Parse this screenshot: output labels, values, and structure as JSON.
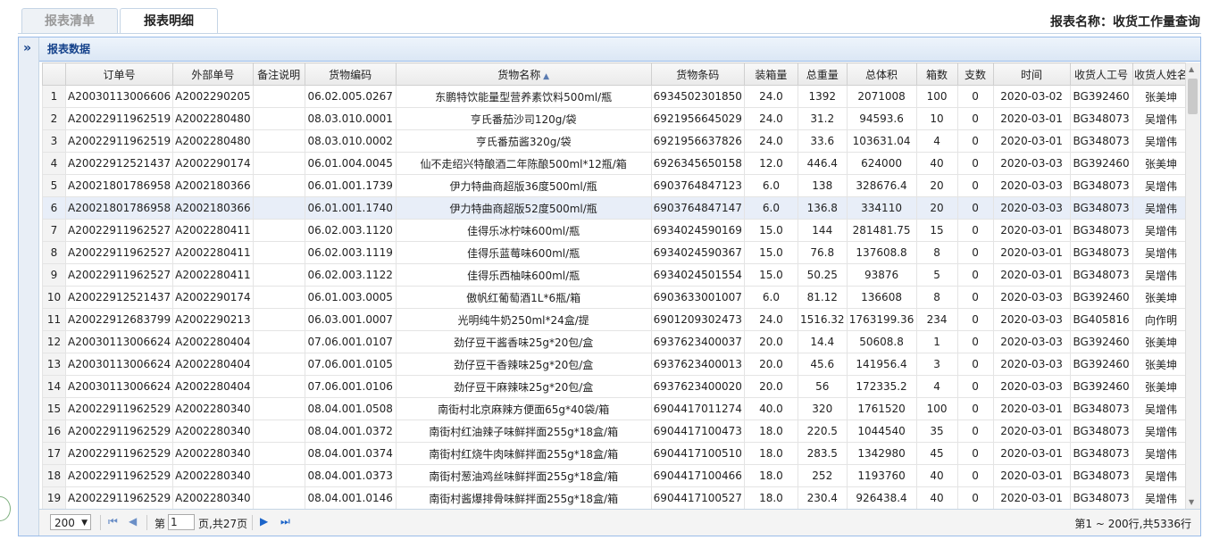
{
  "tabs": [
    {
      "label": "报表清单",
      "active": false
    },
    {
      "label": "报表明细",
      "active": true
    }
  ],
  "report_name": "报表名称：收货工作量查询",
  "panel": {
    "title": "报表数据",
    "expand_icon": "»"
  },
  "columns": [
    "",
    "订单号",
    "外部单号",
    "备注说明",
    "货物编码",
    "货物名称",
    "货物条码",
    "装箱量",
    "总重量",
    "总体积",
    "箱数",
    "支数",
    "时间",
    "收货人工号",
    "收货人姓名"
  ],
  "sorted_column": "货物名称",
  "rows": [
    [
      "1",
      "A20030113006606",
      "A2002290205",
      "",
      "06.02.005.0267",
      "东鹏特饮能量型营养素饮料500ml/瓶",
      "6934502301850",
      "24.0",
      "1392",
      "2071008",
      "100",
      "0",
      "2020-03-02",
      "BG392460",
      "张美坤"
    ],
    [
      "2",
      "A20022911962519",
      "A2002280480",
      "",
      "08.03.010.0001",
      "亨氏番茄沙司120g/袋",
      "6921956645029",
      "24.0",
      "31.2",
      "94593.6",
      "10",
      "0",
      "2020-03-01",
      "BG348073",
      "吴增伟"
    ],
    [
      "3",
      "A20022911962519",
      "A2002280480",
      "",
      "08.03.010.0002",
      "亨氏番茄酱320g/袋",
      "6921956637826",
      "24.0",
      "33.6",
      "103631.04",
      "4",
      "0",
      "2020-03-01",
      "BG348073",
      "吴增伟"
    ],
    [
      "4",
      "A20022912521437",
      "A2002290174",
      "",
      "06.01.004.0045",
      "仙不走绍兴特酿酒二年陈酿500ml*12瓶/箱",
      "6926345650158",
      "12.0",
      "446.4",
      "624000",
      "40",
      "0",
      "2020-03-03",
      "BG392460",
      "张美坤"
    ],
    [
      "5",
      "A20021801786958",
      "A2002180366",
      "",
      "06.01.001.1739",
      "伊力特曲商超版36度500ml/瓶",
      "6903764847123",
      "6.0",
      "138",
      "328676.4",
      "20",
      "0",
      "2020-03-03",
      "BG348073",
      "吴增伟"
    ],
    [
      "6",
      "A20021801786958",
      "A2002180366",
      "",
      "06.01.001.1740",
      "伊力特曲商超版52度500ml/瓶",
      "6903764847147",
      "6.0",
      "136.8",
      "334110",
      "20",
      "0",
      "2020-03-03",
      "BG348073",
      "吴增伟"
    ],
    [
      "7",
      "A20022911962527",
      "A2002280411",
      "",
      "06.02.003.1120",
      "佳得乐冰柠味600ml/瓶",
      "6934024590169",
      "15.0",
      "144",
      "281481.75",
      "15",
      "0",
      "2020-03-01",
      "BG348073",
      "吴增伟"
    ],
    [
      "8",
      "A20022911962527",
      "A2002280411",
      "",
      "06.02.003.1119",
      "佳得乐蓝莓味600ml/瓶",
      "6934024590367",
      "15.0",
      "76.8",
      "137608.8",
      "8",
      "0",
      "2020-03-01",
      "BG348073",
      "吴增伟"
    ],
    [
      "9",
      "A20022911962527",
      "A2002280411",
      "",
      "06.02.003.1122",
      "佳得乐西柚味600ml/瓶",
      "6934024501554",
      "15.0",
      "50.25",
      "93876",
      "5",
      "0",
      "2020-03-01",
      "BG348073",
      "吴增伟"
    ],
    [
      "10",
      "A20022912521437",
      "A2002290174",
      "",
      "06.01.003.0005",
      "傲帆红葡萄酒1L*6瓶/箱",
      "6903633001007",
      "6.0",
      "81.12",
      "136608",
      "8",
      "0",
      "2020-03-03",
      "BG392460",
      "张美坤"
    ],
    [
      "11",
      "A20022912683799",
      "A2002290213",
      "",
      "06.03.001.0007",
      "光明纯牛奶250ml*24盒/提",
      "6901209302473",
      "24.0",
      "1516.32",
      "1763199.36",
      "234",
      "0",
      "2020-03-03",
      "BG405816",
      "向作明"
    ],
    [
      "12",
      "A20030113006624",
      "A2002280404",
      "",
      "07.06.001.0107",
      "劲仔豆干酱香味25g*20包/盒",
      "6937623400037",
      "20.0",
      "14.4",
      "50608.8",
      "1",
      "0",
      "2020-03-03",
      "BG392460",
      "张美坤"
    ],
    [
      "13",
      "A20030113006624",
      "A2002280404",
      "",
      "07.06.001.0105",
      "劲仔豆干香辣味25g*20包/盒",
      "6937623400013",
      "20.0",
      "45.6",
      "141956.4",
      "3",
      "0",
      "2020-03-03",
      "BG392460",
      "张美坤"
    ],
    [
      "14",
      "A20030113006624",
      "A2002280404",
      "",
      "07.06.001.0106",
      "劲仔豆干麻辣味25g*20包/盒",
      "6937623400020",
      "20.0",
      "56",
      "172335.2",
      "4",
      "0",
      "2020-03-03",
      "BG392460",
      "张美坤"
    ],
    [
      "15",
      "A20022911962529",
      "A2002280340",
      "",
      "08.04.001.0508",
      "南街村北京麻辣方便面65g*40袋/箱",
      "6904417011274",
      "40.0",
      "320",
      "1761520",
      "100",
      "0",
      "2020-03-01",
      "BG348073",
      "吴增伟"
    ],
    [
      "16",
      "A20022911962529",
      "A2002280340",
      "",
      "08.04.001.0372",
      "南街村红油辣子味鲜拌面255g*18盒/箱",
      "6904417100473",
      "18.0",
      "220.5",
      "1044540",
      "35",
      "0",
      "2020-03-01",
      "BG348073",
      "吴增伟"
    ],
    [
      "17",
      "A20022911962529",
      "A2002280340",
      "",
      "08.04.001.0374",
      "南街村红烧牛肉味鲜拌面255g*18盒/箱",
      "6904417100510",
      "18.0",
      "283.5",
      "1342980",
      "45",
      "0",
      "2020-03-01",
      "BG348073",
      "吴增伟"
    ],
    [
      "18",
      "A20022911962529",
      "A2002280340",
      "",
      "08.04.001.0373",
      "南街村葱油鸡丝味鲜拌面255g*18盒/箱",
      "6904417100466",
      "18.0",
      "252",
      "1193760",
      "40",
      "0",
      "2020-03-01",
      "BG348073",
      "吴增伟"
    ],
    [
      "19",
      "A20022911962529",
      "A2002280340",
      "",
      "08.04.001.0146",
      "南街村酱爆排骨味鲜拌面255g*18盒/箱",
      "6904417100527",
      "18.0",
      "230.4",
      "926438.4",
      "40",
      "0",
      "2020-03-01",
      "BG348073",
      "吴增伟"
    ]
  ],
  "selected_row": 6,
  "pager": {
    "page_size": "200",
    "page_label_before": "第",
    "page_value": "1",
    "page_label_after": "页,共27页",
    "info": "第1 ~ 200行,共5336行"
  }
}
